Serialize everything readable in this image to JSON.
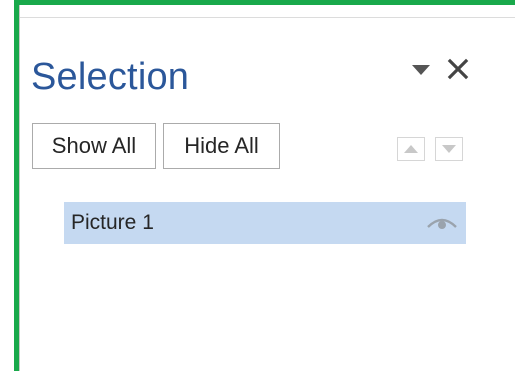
{
  "pane": {
    "title": "Selection",
    "buttons": {
      "show_all": "Show All",
      "hide_all": "Hide All"
    },
    "icons": {
      "menu": "chevron-down-icon",
      "close": "close-icon",
      "move_up": "arrow-up-icon",
      "move_down": "arrow-down-icon",
      "visibility": "eye-icon"
    },
    "items": [
      {
        "label": "Picture 1",
        "selected": true,
        "visible": true
      }
    ]
  },
  "colors": {
    "accent_border": "#19a94b",
    "title": "#2b579a",
    "selected_row": "#c5d9f1"
  }
}
